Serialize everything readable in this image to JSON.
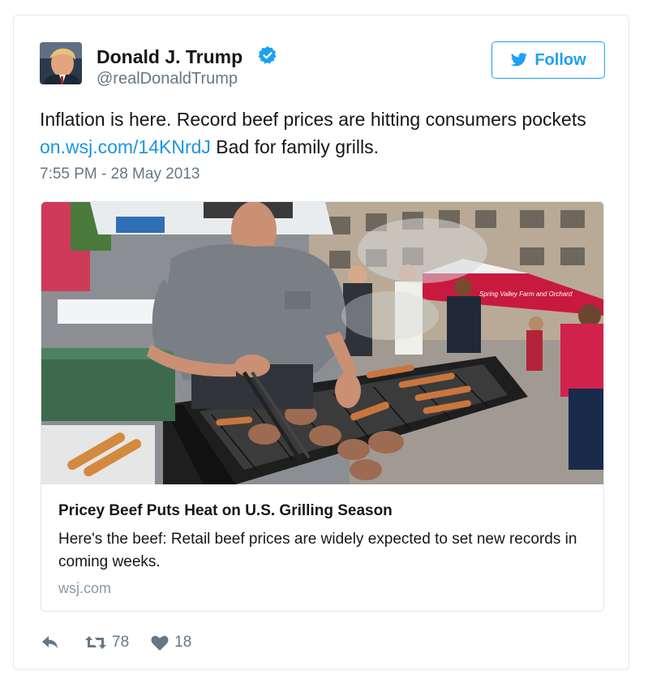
{
  "tweet": {
    "author_name": "Donald J. Trump",
    "author_handle": "@realDonaldTrump",
    "follow_label": "Follow",
    "text_part1": "Inflation is here. Record beef prices are hitting consumers pockets ",
    "link_text": "on.wsj.com/14KNrdJ",
    "text_part2": " Bad for family grills.",
    "timestamp": "7:55 PM - 28 May 2013",
    "retweets": "78",
    "likes": "18"
  },
  "link_card": {
    "title": "Pricey Beef Puts Heat on U.S. Grilling Season",
    "description": "Here's the beef: Retail beef prices are widely expected to set new records in coming weeks.",
    "domain": "wsj.com",
    "banner_text": "Spring Valley Farm and Orchard"
  },
  "icons": {
    "verified": "verified-badge-icon",
    "follow": "twitter-bird-icon",
    "reply": "reply-icon",
    "retweet": "retweet-icon",
    "like": "heart-icon"
  },
  "colors": {
    "accent": "#1da1f2",
    "link": "#1b95e0",
    "muted": "#657786",
    "border": "#e1e8ed"
  }
}
